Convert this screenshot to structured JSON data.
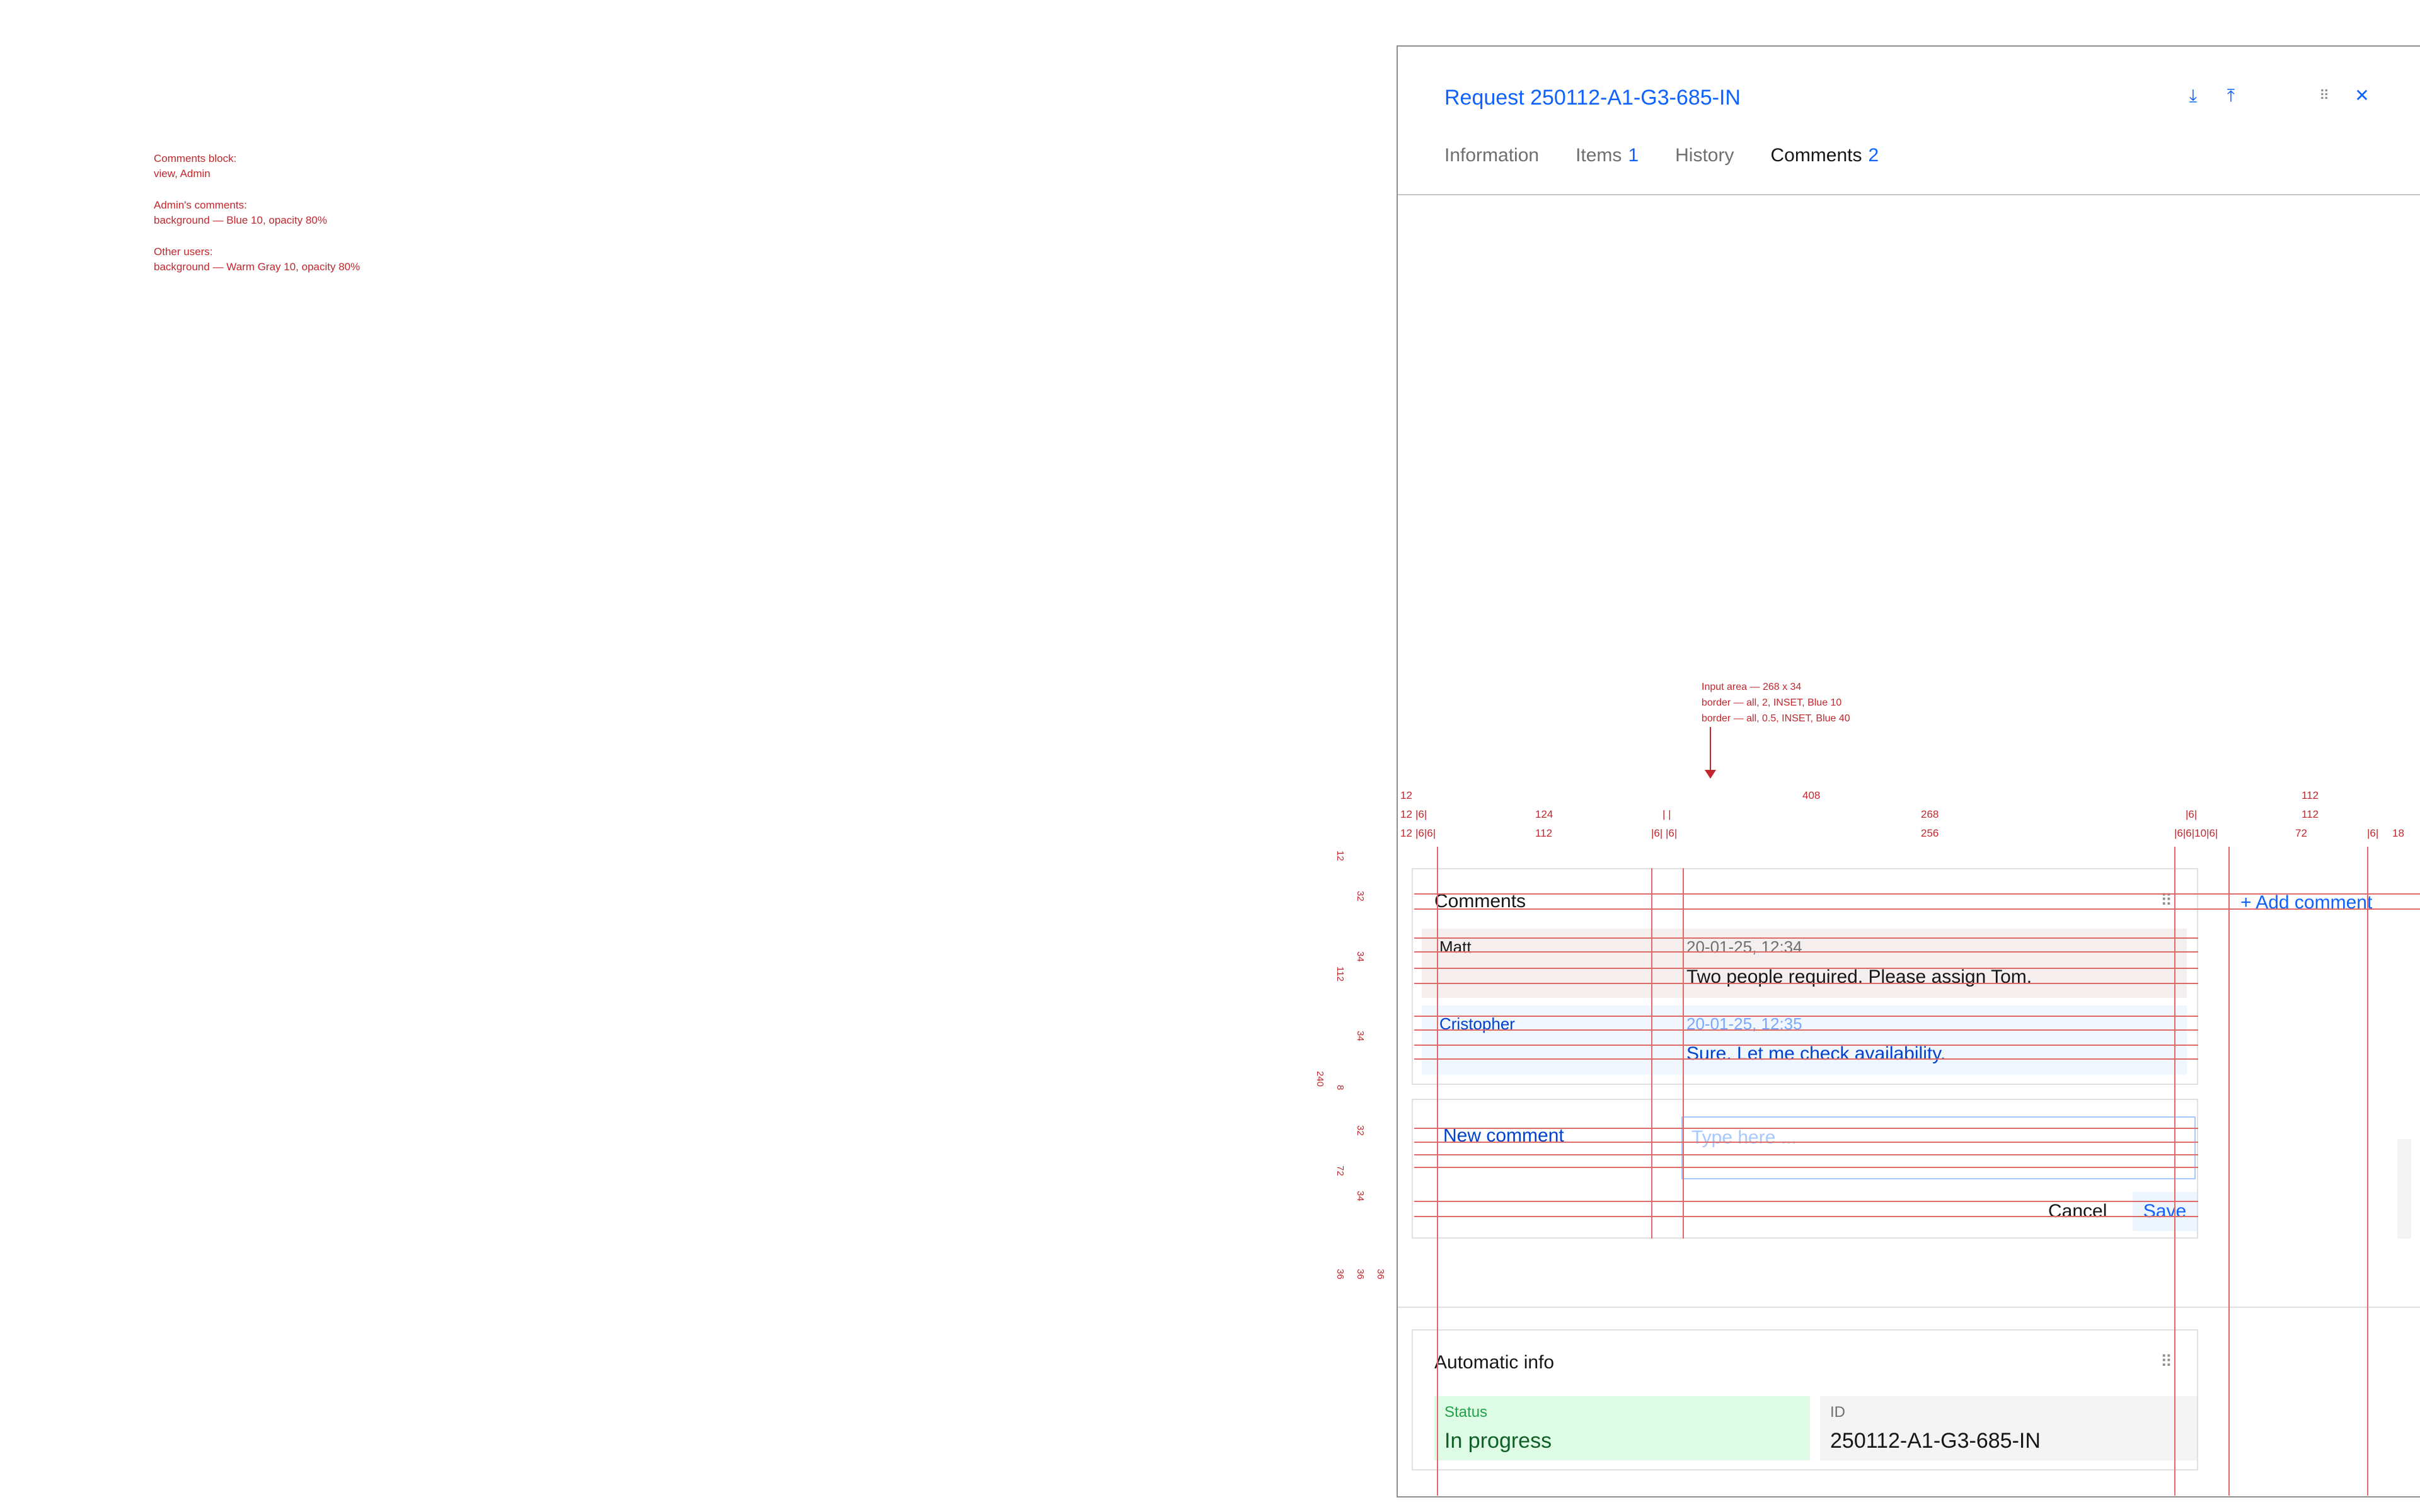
{
  "notes": {
    "lines": [
      [
        "Comments block:",
        "view, Admin"
      ],
      [
        "Admin's comments:",
        "background — Blue 10, opacity 80%"
      ],
      [
        "Other users:",
        "background — Warm Gray 10, opacity 80%"
      ]
    ]
  },
  "request": {
    "title": "Request 250112-A1-G3-685-IN",
    "icons": [
      "download-icon",
      "upload-icon",
      "drag-icon",
      "close-icon"
    ]
  },
  "tabs": [
    {
      "label": "Information",
      "count": ""
    },
    {
      "label": "Items",
      "count": "1"
    },
    {
      "label": "History",
      "count": ""
    },
    {
      "label": "Comments",
      "count": "2"
    }
  ],
  "callout": {
    "lines": [
      "Input area — 268 x 34",
      "border — all, 2, INSET, Blue 10",
      "border — all, 0.5, INSET, Blue 40"
    ]
  },
  "measures": {
    "row1": [
      "12",
      "408",
      "112"
    ],
    "row2": [
      "12",
      "|6|",
      "124",
      "| |",
      "268",
      "|6|",
      "112"
    ],
    "row3": [
      "12",
      "|6|6|",
      "112",
      "|6| |6|",
      "256",
      "|6|6|10|6|",
      "72",
      "|6|",
      "18"
    ],
    "vertical": [
      "12",
      "32",
      "34",
      "112",
      "34",
      "240",
      "8",
      "32",
      "72",
      "34",
      "36",
      "36",
      "36"
    ]
  },
  "comments_block": {
    "title": "Comments",
    "add_label": "+ Add comment",
    "comments": [
      {
        "author": "Matt",
        "time": "20-01-25, 12:34",
        "text": "Two people required. Please assign Tom.",
        "role": "other"
      },
      {
        "author": "Cristopher",
        "time": "20-01-25, 12:35",
        "text": "Sure. Let me check availability.",
        "role": "admin"
      }
    ],
    "new_comment_label": "New comment",
    "input_placeholder": "Type here ...",
    "cancel_label": "Cancel",
    "save_label": "Save"
  },
  "auto_info": {
    "title": "Automatic info",
    "status_label": "Status",
    "status_value": "In progress",
    "id_label": "ID",
    "id_value": "250112-A1-G3-685-IN"
  },
  "colors": {
    "accent": "#0f62fe",
    "annotation": "#c1272d",
    "admin_bg": "#edf5ff",
    "other_bg": "#f2eaea",
    "status_bg": "#defbe6"
  }
}
